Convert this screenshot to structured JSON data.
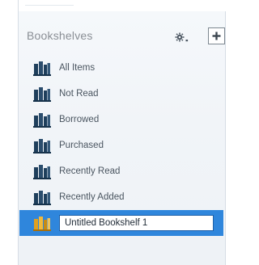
{
  "sidebar": {
    "title": "Bookshelves",
    "settings_icon": "gear-icon",
    "add_icon": "plus-icon",
    "items": [
      {
        "label": "All Items",
        "icon": "bookshelf-icon"
      },
      {
        "label": "Not Read",
        "icon": "bookshelf-icon"
      },
      {
        "label": "Borrowed",
        "icon": "bookshelf-icon"
      },
      {
        "label": "Purchased",
        "icon": "bookshelf-icon"
      },
      {
        "label": "Recently Read",
        "icon": "bookshelf-icon"
      },
      {
        "label": "Recently Added",
        "icon": "bookshelf-icon"
      }
    ],
    "editing_item": {
      "value": "Untitled Bookshelf 1",
      "icon": "bookshelf-icon"
    }
  },
  "colors": {
    "selection": "#2f86dc",
    "shelf_icon": "#1f3f5c",
    "shelf_icon_selected": "#e0a020",
    "title_text": "#8a8f95",
    "item_text": "#4a5560"
  }
}
